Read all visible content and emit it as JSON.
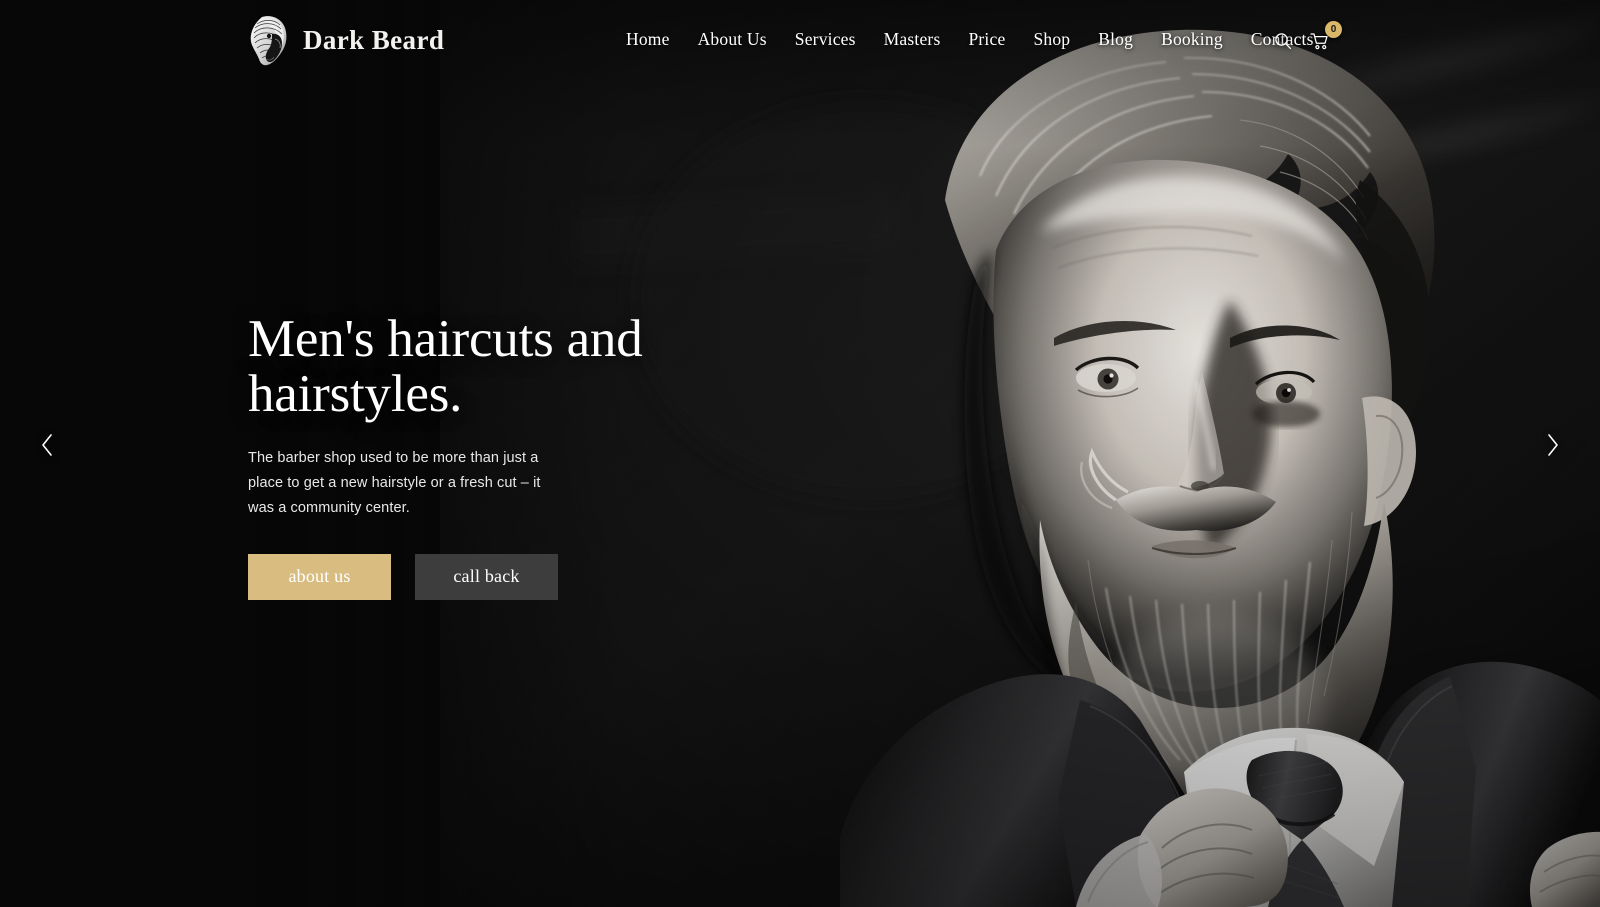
{
  "site": {
    "brand_name": "Dark Beard",
    "logo_icon": "bearded-man-head-icon"
  },
  "nav": {
    "items": [
      {
        "label": "Home"
      },
      {
        "label": "About Us"
      },
      {
        "label": "Services"
      },
      {
        "label": "Masters"
      },
      {
        "label": "Price"
      },
      {
        "label": "Shop"
      },
      {
        "label": "Blog"
      },
      {
        "label": "Booking"
      },
      {
        "label": "Contacts"
      }
    ],
    "search_icon": "search-icon",
    "cart_icon": "shopping-cart-icon",
    "cart_count": "0"
  },
  "hero": {
    "title": "Men's haircuts and hairstyles.",
    "description": "The barber shop used to be more than just a place to get a new hairstyle or a fresh cut – it was a community center.",
    "primary_button": "about us",
    "secondary_button": "call back",
    "prev_arrow_icon": "chevron-left-icon",
    "next_arrow_icon": "chevron-right-icon",
    "image_alt": "black-and-white portrait of bearded man in suit adjusting his tie"
  },
  "theme": {
    "background": "#080808",
    "accent_gold": "#d9bc80",
    "badge_gold": "#d9b869",
    "secondary_button": "#3d3d3d",
    "text_primary": "#ffffff",
    "text_body": "#e8e8e8"
  }
}
